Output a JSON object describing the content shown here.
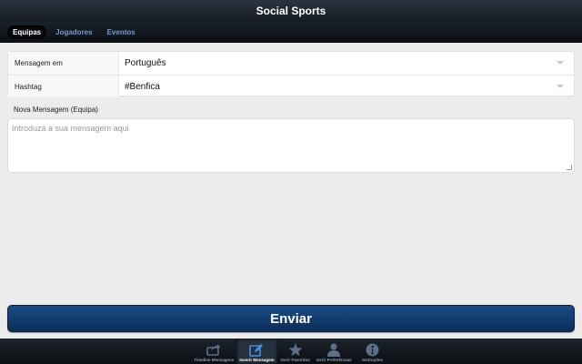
{
  "app": {
    "title": "Social Sports"
  },
  "tabs": [
    {
      "label": "Equipas",
      "active": true
    },
    {
      "label": "Jogadores",
      "active": false
    },
    {
      "label": "Eventos",
      "active": false
    }
  ],
  "form": {
    "language": {
      "label": "Mensagem em",
      "value": "Português"
    },
    "hashtag": {
      "label": "Hashtag",
      "value": "#Benfica"
    }
  },
  "message": {
    "label": "Nova Mensagem (Equipa)",
    "placeholder": "Introduza a sua mensagem aqui"
  },
  "submit": {
    "label": "Enviar"
  },
  "bottom_nav": [
    {
      "label": "Timeline Mensagens",
      "icon": "share-icon",
      "active": false
    },
    {
      "label": "Inserir Mensagem",
      "icon": "compose-icon",
      "active": true
    },
    {
      "label": "Gerir Favoritos",
      "icon": "star-icon",
      "active": false
    },
    {
      "label": "Gerir Preferências",
      "icon": "user-icon",
      "active": false
    },
    {
      "label": "Instruções",
      "icon": "info-icon",
      "active": false
    }
  ],
  "colors": {
    "accent": "#1b4d86",
    "tab_link": "#6f9bd0",
    "background": "#ececec"
  }
}
